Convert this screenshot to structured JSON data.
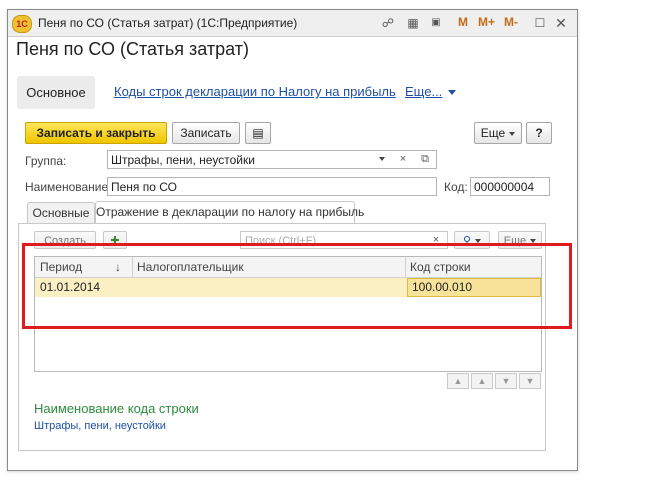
{
  "window": {
    "app_icon": "1С",
    "title": "Пеня по СО (Статья затрат)  (1С:Предприятие)",
    "m_buttons": [
      "M",
      "M+",
      "M-"
    ]
  },
  "header": {
    "title": "Пеня по СО (Статья затрат)"
  },
  "nav": {
    "main": "Основное",
    "link": "Коды строк декларации по Налогу на прибыль",
    "more": "Еще..."
  },
  "toolbar": {
    "save_close": "Записать и закрыть",
    "save": "Записать",
    "more": "Еще",
    "help": "?"
  },
  "form": {
    "group_label": "Группа:",
    "group_value": "Штрафы, пени, неустойки",
    "name_label": "Наименование:",
    "name_value": "Пеня по СО",
    "code_label": "Код:",
    "code_value": "000000004"
  },
  "tabs": [
    "Основные",
    "Отражение в декларации по налогу на прибыль"
  ],
  "subtoolbar": {
    "create": "Создать",
    "search_placeholder": "Поиск (Ctrl+F)",
    "more": "Еще"
  },
  "table": {
    "columns": [
      "Период",
      "Налогоплательщик",
      "Код строки"
    ],
    "sort_indicator": "↓",
    "rows": [
      {
        "period": "01.01.2014",
        "taxpayer": "",
        "code": "100.00.010"
      }
    ]
  },
  "details": {
    "label": "Наименование кода строки",
    "value": "Штрафы, пени, неустойки"
  }
}
